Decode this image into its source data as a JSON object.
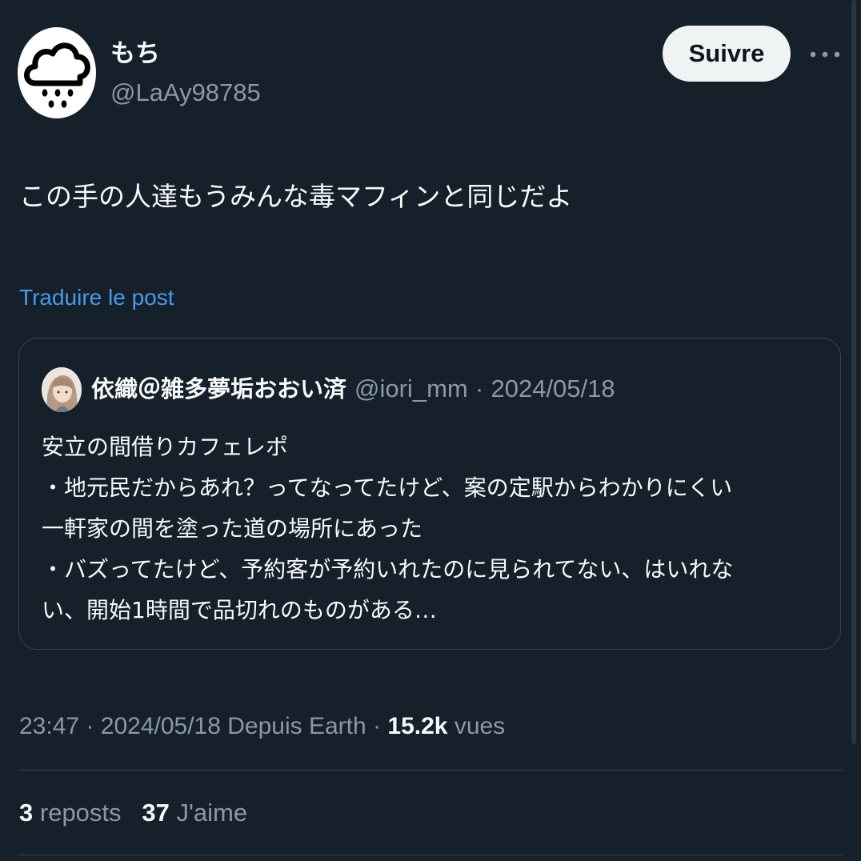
{
  "author": {
    "display_name": "もち",
    "handle": "@LaAy98785",
    "avatar_icon": "rain-cloud-icon"
  },
  "actions": {
    "follow_label": "Suivre",
    "more_icon": "more-horizontal-icon"
  },
  "tweet": {
    "text": "この手の人達もうみんな毒マフィンと同じだよ",
    "translate_label": "Traduire le post"
  },
  "quote": {
    "name": "依織＠雑多夢垢おおい済",
    "handle": "@iori_mm",
    "separator": "·",
    "date": "2024/05/18",
    "lines": [
      "安立の間借りカフェレポ",
      "・地元民だからあれ？ってなってたけど、案の定駅からわかりにくい",
      "一軒家の間を塗った道の場所にあった",
      "・バズってたけど、予約客が予約いれたのに見られてない、はいれな",
      "い、開始1時間で品切れのものがある…"
    ]
  },
  "meta": {
    "time": "23:47",
    "separator": "·",
    "date": "2024/05/18",
    "source": "Depuis Earth",
    "views_count": "15.2k",
    "views_label": "vues"
  },
  "stats": {
    "reposts_count": "3",
    "reposts_label": "reposts",
    "likes_count": "37",
    "likes_label": "J'aime"
  },
  "colors": {
    "background": "#15202b",
    "text": "#f7f9f9",
    "muted": "#8b98a5",
    "link": "#4a99e9",
    "border": "#38444d",
    "button_bg": "#eff3f4"
  }
}
